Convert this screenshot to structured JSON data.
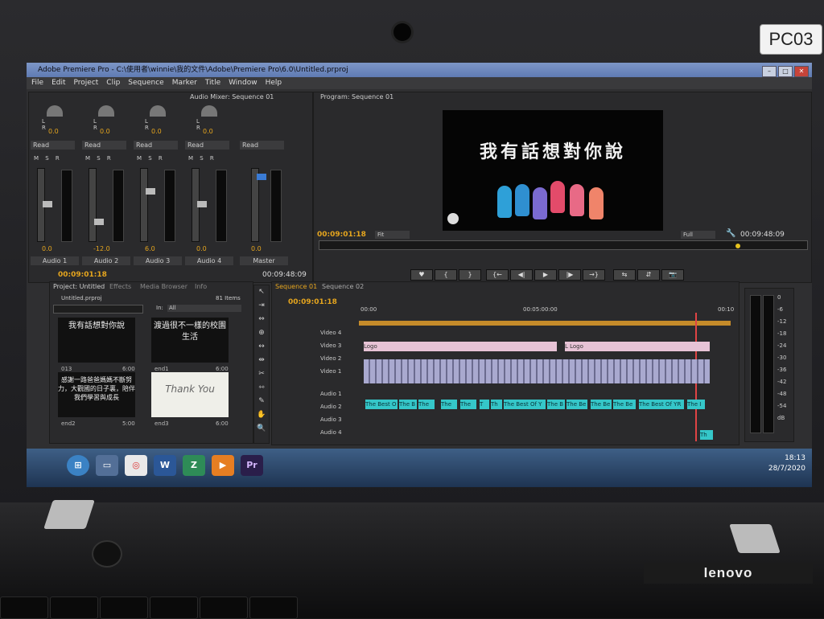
{
  "window": {
    "title": "Adobe Premiere Pro - C:\\使用者\\winnie\\我的文件\\Adobe\\Premiere Pro\\6.0\\Untitled.prproj",
    "controls": [
      "–",
      "□",
      "✕"
    ]
  },
  "menu": [
    "File",
    "Edit",
    "Project",
    "Clip",
    "Sequence",
    "Marker",
    "Title",
    "Window",
    "Help"
  ],
  "audio_mixer": {
    "tab_label": "Audio Mixer: Sequence 01",
    "channels": [
      {
        "name": "Audio 1",
        "pan": "0.0",
        "mode": "Read",
        "value": "0.0"
      },
      {
        "name": "Audio 2",
        "pan": "0.0",
        "mode": "Read",
        "value": "-12.0"
      },
      {
        "name": "Audio 3",
        "pan": "0.0",
        "mode": "Read",
        "value": "6.0"
      },
      {
        "name": "Audio 4",
        "pan": "0.0",
        "mode": "Read",
        "value": "0.0"
      },
      {
        "name": "Master",
        "pan": "",
        "mode": "Read",
        "value": "0.0"
      }
    ],
    "msr": "M S R",
    "lr": "L R",
    "timecode_left": "00:09:01:18",
    "timecode_right": "00:09:48:09"
  },
  "program_monitor": {
    "tab_label": "Program: Sequence 01",
    "frame_title": "我有話想對你說",
    "timecode_left": "00:09:01:18",
    "fit": "Fit",
    "quality": "Full",
    "timecode_right": "00:09:48:09",
    "controls": [
      "♥",
      "{",
      "}",
      "{←",
      "◀|",
      "▶",
      "|▶",
      "→}",
      "⇆",
      "⇵",
      "📷"
    ]
  },
  "project": {
    "tabs": [
      "Project: Untitled",
      "Effects",
      "Media Browser",
      "Info"
    ],
    "file": "Untitled.prproj",
    "items_count": "81 Items",
    "in_label": "In:",
    "in_value": "All",
    "thumbs": [
      {
        "text": "我有話想對你說",
        "label": "013",
        "dur": "6:00"
      },
      {
        "text": "渡過很不一樣的校園生活",
        "label": "end1",
        "dur": "6:00"
      },
      {
        "text": "感謝一路爸爸媽媽不斷努力，大觀國的日子裏，陪伴我們學習與成長",
        "label": "end2",
        "dur": "5:00"
      },
      {
        "text": "Thank You",
        "label": "end3",
        "dur": "6:00"
      }
    ]
  },
  "tools": [
    "↖",
    "⇥",
    "⇔",
    "⊕",
    "↔",
    "⇹",
    "✂",
    "⇿",
    "✎",
    "✋",
    "🔍"
  ],
  "timeline": {
    "tabs": [
      "Sequence 01",
      "Sequence 02"
    ],
    "timecode": "00:09:01:18",
    "ruler": [
      "00:00",
      "00:05:00:00",
      "00:10"
    ],
    "tracks": [
      {
        "label": "Video 4",
        "kind": "v"
      },
      {
        "label": "Video 3",
        "kind": "v"
      },
      {
        "label": "Video 2",
        "kind": "v"
      },
      {
        "label": "Video 1",
        "kind": "v"
      },
      {
        "label": "Audio 1",
        "kind": "a"
      },
      {
        "label": "Audio 2",
        "kind": "a"
      },
      {
        "label": "Audio 3",
        "kind": "a"
      },
      {
        "label": "Audio 4",
        "kind": "a"
      }
    ],
    "logo_clips": [
      "Logo",
      "L Logo"
    ],
    "audio_clips": [
      "The Best O",
      "The B",
      "The",
      "The",
      "The",
      "T",
      "Th",
      "The Best Of Y",
      "The B",
      "The Be",
      "The Be",
      "The Be",
      "The Best Of YR",
      "The I",
      "Th"
    ]
  },
  "master_meter": [
    "0",
    "-6",
    "-12",
    "-18",
    "-24",
    "-30",
    "-36",
    "-42",
    "-48",
    "-54",
    "dB"
  ],
  "taskbar": {
    "apps": [
      "⊞",
      "▭",
      "◎",
      "W",
      "Z",
      "▶",
      "Pr"
    ],
    "time": "18:13",
    "date": "28/7/2020"
  },
  "laptop": {
    "sticker": "PC03",
    "brand": "lenovo"
  }
}
